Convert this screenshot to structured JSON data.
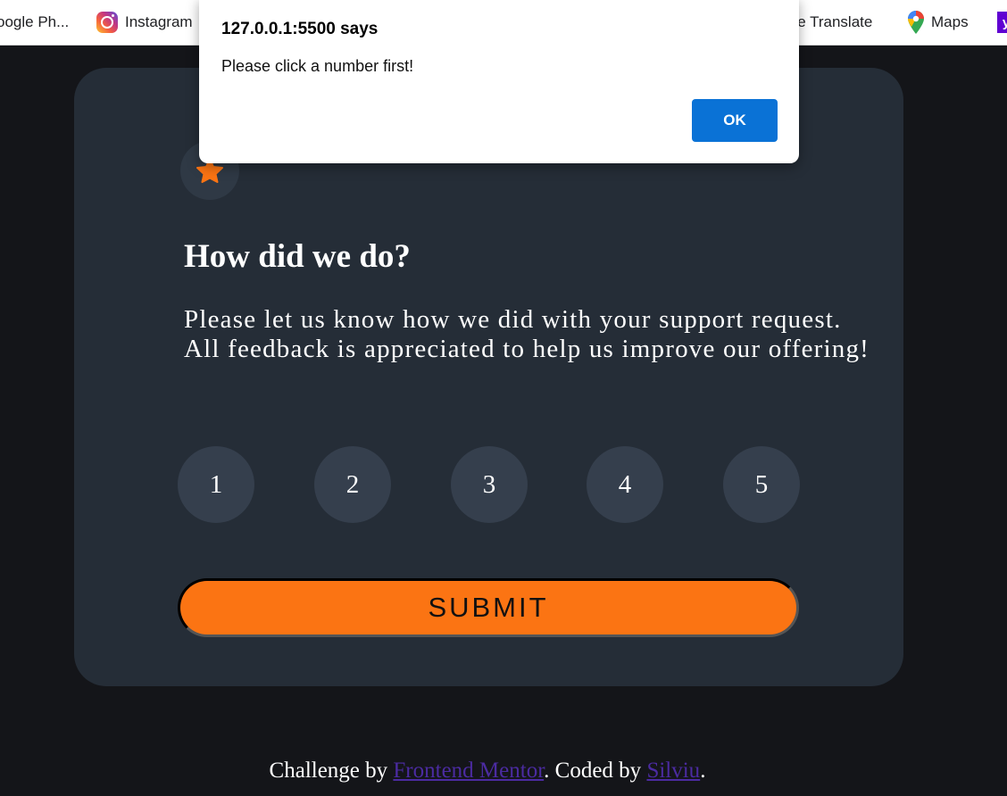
{
  "bookmarks": {
    "items": [
      {
        "label": "oogle Ph...",
        "icon": "google-photos-icon"
      },
      {
        "label": "Instagram",
        "icon": "instagram-icon"
      },
      {
        "label": "gle Translate",
        "icon": "google-translate-icon"
      },
      {
        "label": "Maps",
        "icon": "maps-pin-icon"
      },
      {
        "label": "",
        "icon": "yahoo-icon"
      }
    ]
  },
  "card": {
    "icon": "star-icon",
    "title": "How did we do?",
    "description": "Please let us know how we did with your support request. All feedback is appreciated to help us improve our offering!",
    "ratings": [
      "1",
      "2",
      "3",
      "4",
      "5"
    ],
    "submit_label": "SUBMIT"
  },
  "footer": {
    "prefix": "Challenge by ",
    "link1": "Frontend Mentor",
    "middle": ". Coded by ",
    "link2": "Silviu",
    "suffix": "."
  },
  "dialog": {
    "title": "127.0.0.1:5500 says",
    "message": "Please click a number first!",
    "ok_label": "OK"
  },
  "colors": {
    "page_bg": "#141519",
    "card_bg": "#252d37",
    "rating_bg": "#353f4d",
    "accent": "#fb7413",
    "link": "#4b2ba1",
    "dialog_button": "#0a72d6"
  }
}
